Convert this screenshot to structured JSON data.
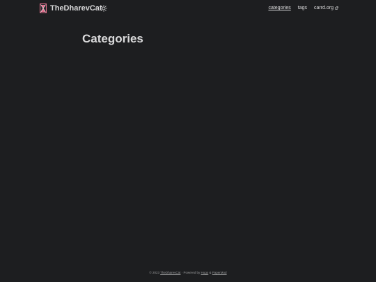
{
  "site": {
    "title": "TheDharevCat"
  },
  "nav": {
    "items": [
      {
        "label": "categories",
        "active": true
      },
      {
        "label": "tags",
        "active": false
      },
      {
        "label": "carrd.org",
        "active": false,
        "external": true
      }
    ]
  },
  "main": {
    "title": "Categories"
  },
  "footer": {
    "copyright": "© 2023",
    "site_link": "TheDharevCat",
    "powered_by": "· Powered by",
    "hugo": "Hugo",
    "amp": "&",
    "papermod": "PaperMod"
  },
  "colors": {
    "background": "#1d1e20",
    "text": "#dadadb",
    "secondary": "#9b9c9d",
    "logo_accent": "#e06c8a"
  }
}
